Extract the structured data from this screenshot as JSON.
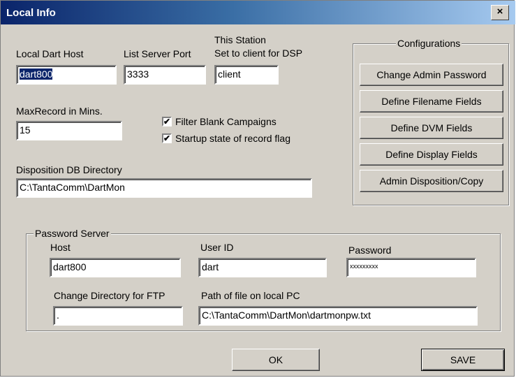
{
  "window": {
    "title": "Local Info",
    "close_glyph": "×"
  },
  "local_dart_host": {
    "label": "Local Dart Host",
    "value": "dart800"
  },
  "list_server_port": {
    "label": "List Server Port",
    "value": "3333"
  },
  "this_station": {
    "label_line1": "This Station",
    "label_line2": "Set to client for DSP",
    "value": "client"
  },
  "max_record": {
    "label": "MaxRecord in Mins.",
    "value": "15"
  },
  "filter_blank": {
    "label": "Filter Blank Campaigns",
    "checked": true,
    "mark": "✔"
  },
  "startup_state": {
    "label": "Startup state of record flag",
    "checked": true,
    "mark": "✔"
  },
  "disposition_dir": {
    "label": "Disposition DB Directory",
    "value": "C:\\TantaComm\\DartMon"
  },
  "configurations": {
    "title": "Configurations",
    "buttons": [
      "Change Admin Password",
      "Define Filename Fields",
      "Define DVM Fields",
      "Define Display Fields",
      "Admin Disposition/Copy"
    ]
  },
  "password_server": {
    "title": "Password Server",
    "host": {
      "label": "Host",
      "value": "dart800"
    },
    "user_id": {
      "label": "User ID",
      "value": "dart"
    },
    "password": {
      "label": "Password",
      "value": "xxxxxxxxx"
    },
    "change_dir": {
      "label": "Change Directory for FTP",
      "value": "."
    },
    "path_file": {
      "label": "Path of file on local PC",
      "value": "C:\\TantaComm\\DartMon\\dartmonpw.txt"
    }
  },
  "footer": {
    "ok_label": "OK",
    "save_label": "SAVE"
  }
}
